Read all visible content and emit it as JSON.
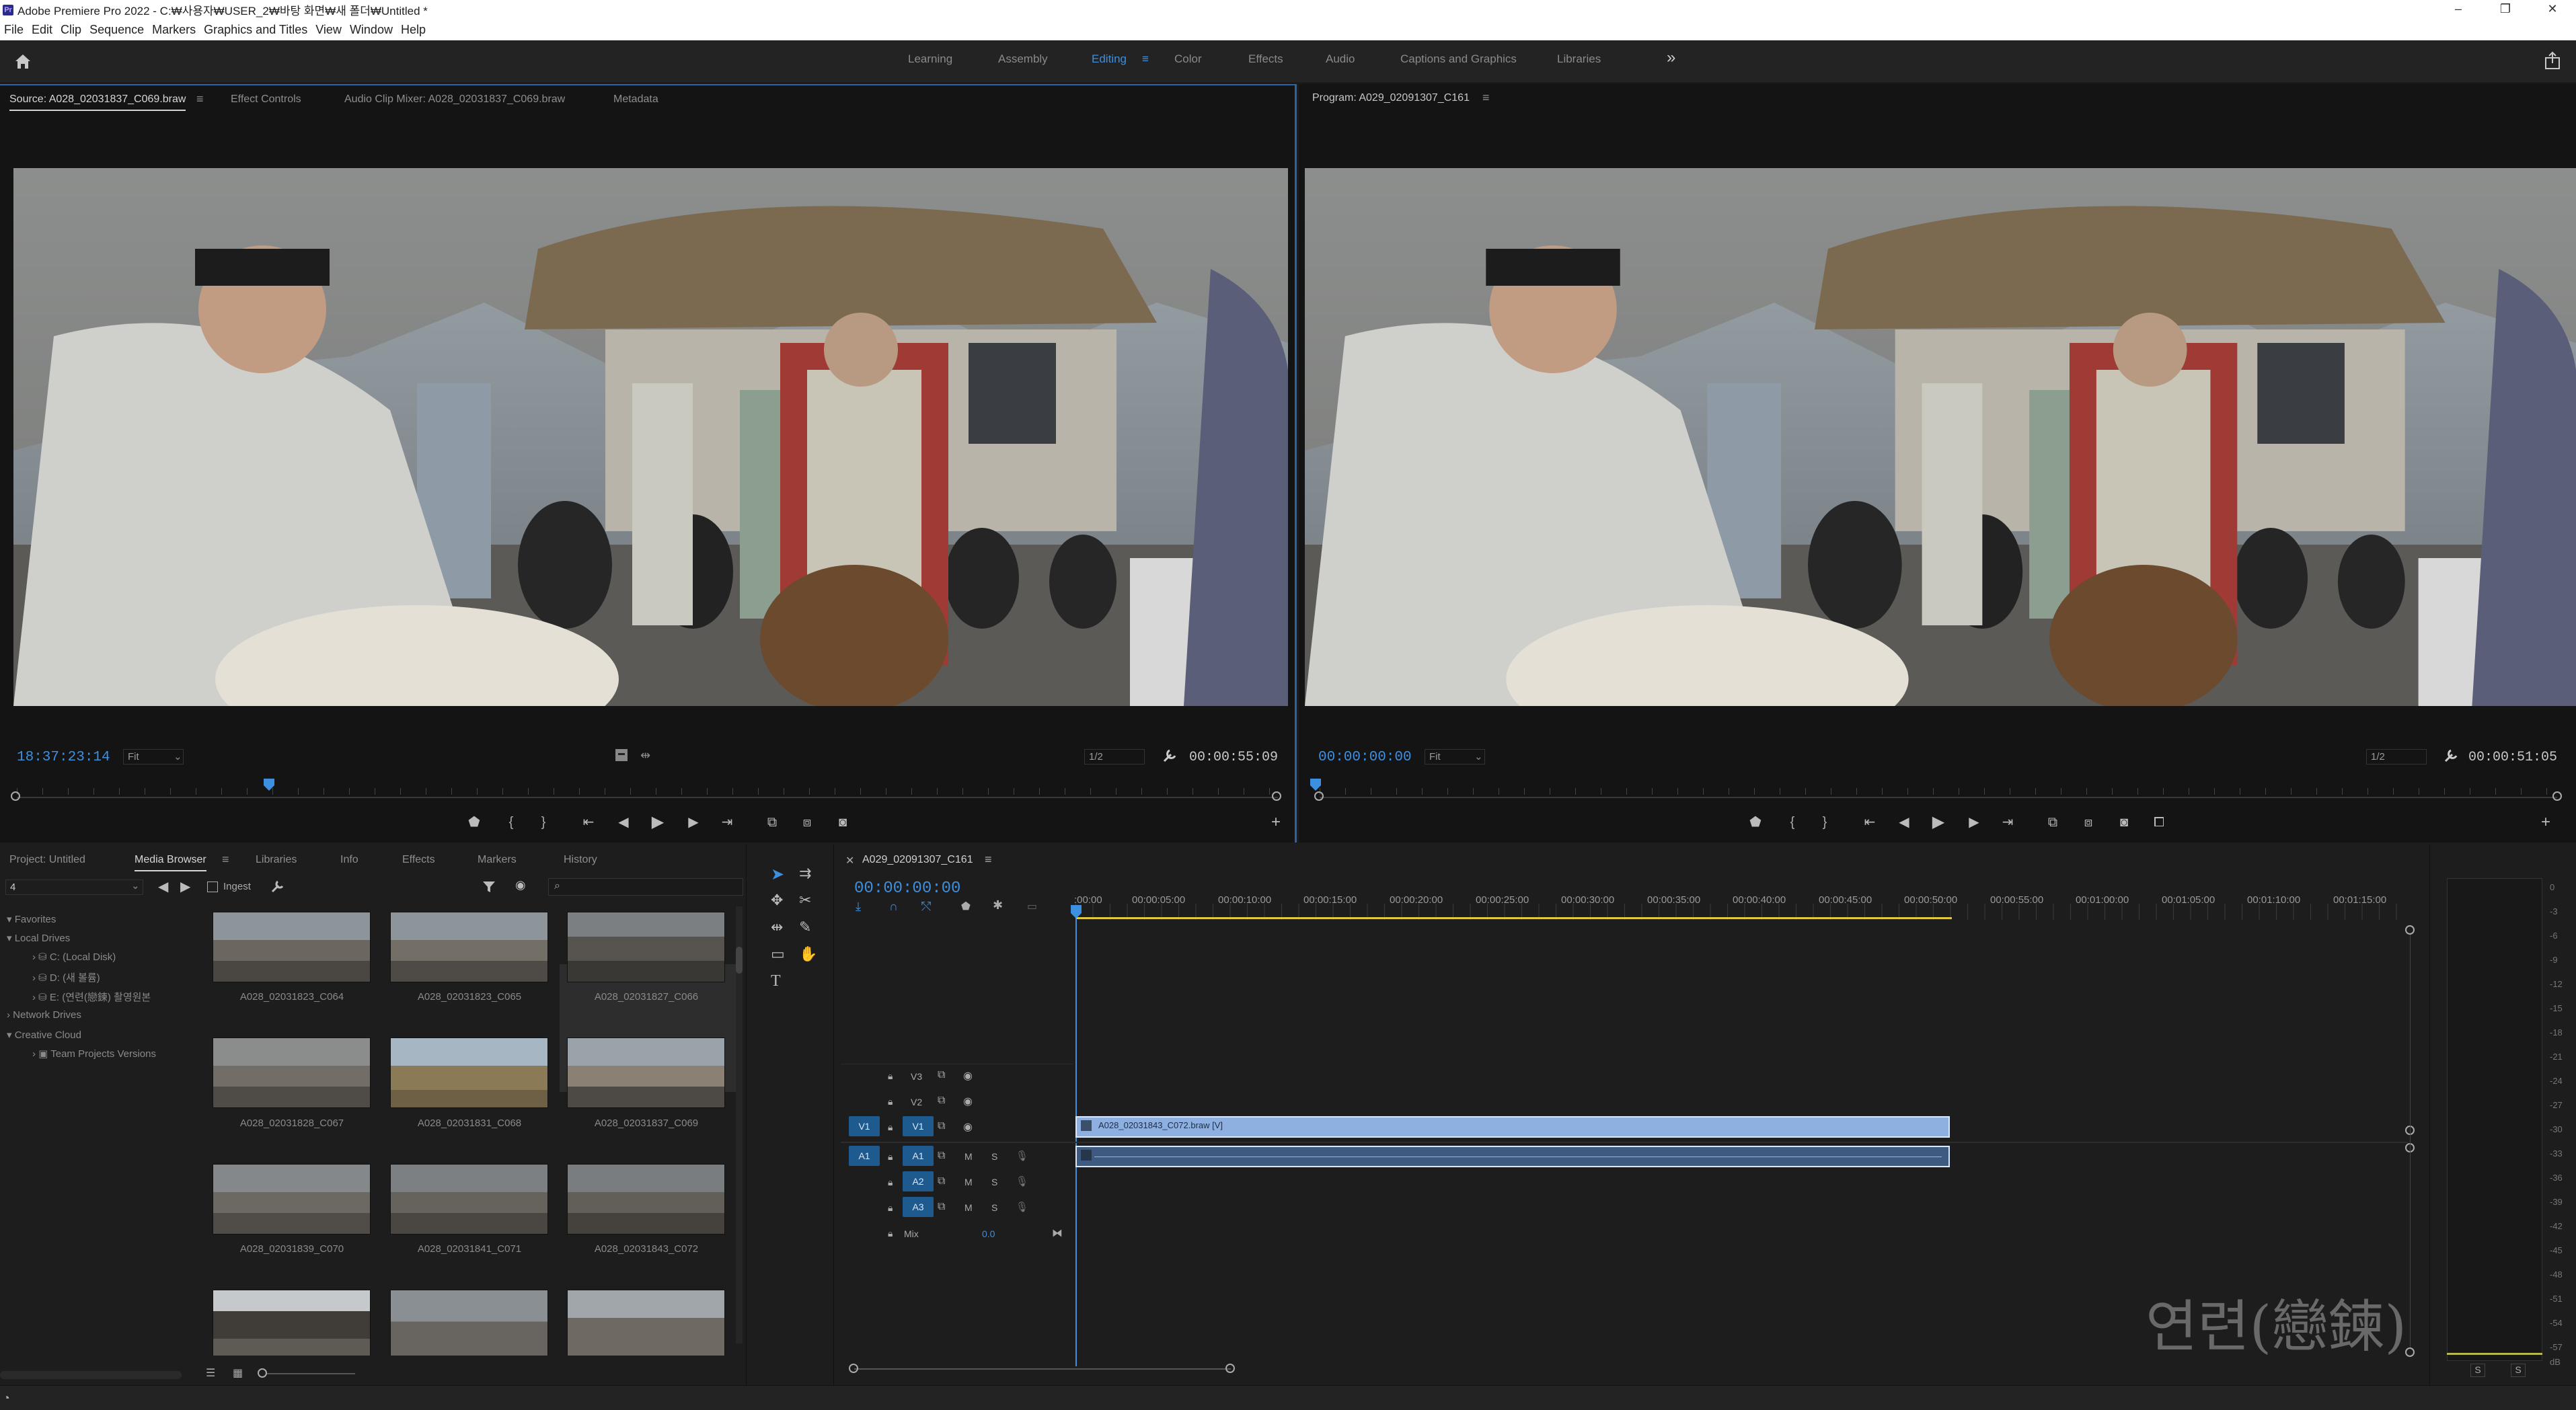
{
  "window": {
    "title": "Adobe Premiere Pro 2022 - C:₩사용자₩USER_2₩바탕 화면₩새 폴더₩Untitled *",
    "app_icon": "Pr",
    "min": "–",
    "max": "❐",
    "close": "✕"
  },
  "menu": [
    "File",
    "Edit",
    "Clip",
    "Sequence",
    "Markers",
    "Graphics and Titles",
    "View",
    "Window",
    "Help"
  ],
  "workspaces": {
    "tabs": [
      "Learning",
      "Assembly",
      "Editing",
      "Color",
      "Effects",
      "Audio",
      "Captions and Graphics",
      "Libraries"
    ],
    "active": "Editing",
    "overflow": "»"
  },
  "source": {
    "tabs": [
      "Source: A028_02031837_C069.braw",
      "Effect Controls",
      "Audio Clip Mixer: A028_02031837_C069.braw",
      "Metadata"
    ],
    "timecode": "18:37:23:14",
    "fit": "Fit",
    "resolution": "1/2",
    "duration": "00:00:55:09"
  },
  "program": {
    "tab": "Program: A029_02091307_C161",
    "timecode": "00:00:00:00",
    "fit": "Fit",
    "resolution": "1/2",
    "duration": "00:00:51:05"
  },
  "project": {
    "tabs": [
      "Project: Untitled",
      "Media Browser",
      "Libraries",
      "Info",
      "Effects",
      "Markers",
      "History"
    ],
    "active": "Media Browser",
    "path": "4",
    "ingest": "Ingest",
    "tree": [
      {
        "label": "Favorites",
        "level": 0
      },
      {
        "label": "Local Drives",
        "level": 0
      },
      {
        "label": "C: (Local Disk)",
        "level": 1
      },
      {
        "label": "D: (새 볼륨)",
        "level": 1
      },
      {
        "label": "E: (연련(戀鍊) 촬영원본",
        "level": 1
      },
      {
        "label": "Network Drives",
        "level": 0
      },
      {
        "label": "Creative Cloud",
        "level": 0
      },
      {
        "label": "Team Projects Versions",
        "level": 1
      }
    ],
    "clips": [
      "A028_02031823_C064",
      "A028_02031823_C065",
      "A028_02031827_C066",
      "A028_02031828_C067",
      "A028_02031831_C068",
      "A028_02031837_C069",
      "A028_02031839_C070",
      "A028_02031841_C071",
      "A028_02031843_C072",
      "",
      "",
      ""
    ]
  },
  "timeline": {
    "tab": "A029_02091307_C161",
    "timecode": "00:00:00:00",
    "ruler": [
      ":00:00",
      "00:00:05:00",
      "00:00:10:00",
      "00:00:15:00",
      "00:00:20:00",
      "00:00:25:00",
      "00:00:30:00",
      "00:00:35:00",
      "00:00:40:00",
      "00:00:45:00",
      "00:00:50:00",
      "00:00:55:00",
      "00:01:00:00",
      "00:01:05:00",
      "00:01:10:00",
      "00:01:15:00"
    ],
    "video_tracks": [
      "V3",
      "V2",
      "V1"
    ],
    "audio_tracks": [
      "A1",
      "A2",
      "A3"
    ],
    "mix_label": "Mix",
    "mix_value": "0.0",
    "src_v": "V1",
    "src_a": "A1",
    "clip_label": "A028_02031843_C072.braw [V]",
    "watermark": "연련(戀鍊)"
  },
  "meter": {
    "scale": [
      "0",
      "-3",
      "-6",
      "-9",
      "-12",
      "-15",
      "-18",
      "-21",
      "-24",
      "-27",
      "-30",
      "-33",
      "-36",
      "-39",
      "-42",
      "-45",
      "-48",
      "-51",
      "-54",
      "-57",
      "dB"
    ],
    "solo": [
      "S",
      "S"
    ]
  },
  "colors": {
    "accent": "#3d8fe0",
    "clip_video": "#8db0e0",
    "clip_audio": "#3e5a80",
    "playhead": "#3d8fe0",
    "workarea": "#e0c840"
  }
}
